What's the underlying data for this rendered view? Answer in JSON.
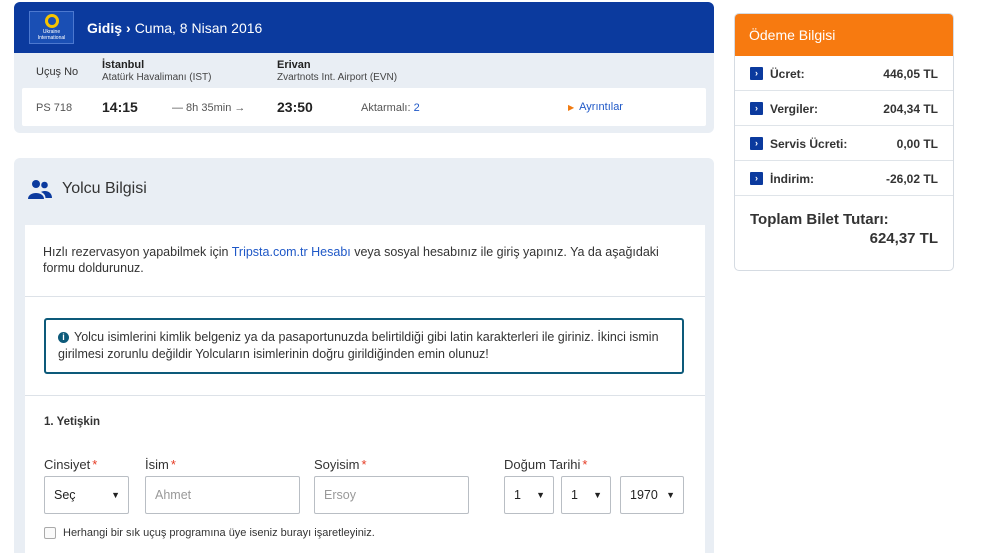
{
  "flight": {
    "airline_logo_text": "Ukraine International",
    "direction": "Gidiş",
    "separator": "›",
    "date": "Cuma, 8 Nisan 2016",
    "flight_no_label": "Uçuş No",
    "origin_city": "İstanbul",
    "origin_airport": "Atatürk Havalimanı (IST)",
    "dest_city": "Erivan",
    "dest_airport": "Zvartnots Int. Airport (EVN)",
    "code": "PS 718",
    "departure": "14:15",
    "duration": "— 8h 35min →",
    "arrival": "23:50",
    "stops_label": "Aktarmalı:",
    "stops_count": "2",
    "details_link": "Ayrıntılar"
  },
  "passenger": {
    "section_title": "Yolcu Bilgisi",
    "intro_pre": "Hızlı rezervasyon yapabilmek için ",
    "intro_link": "Tripsta.com.tr Hesabı",
    "intro_post": " veya sosyal hesabınız ile giriş yapınız. Ya da aşağıdaki formu doldurunuz.",
    "info_note": "Yolcu isimlerini kimlik belgeniz ya da pasaportunuzda belirtildiği gibi latin karakterleri ile giriniz. İkinci ismin girilmesi zorunlu değildir Yolcuların isimlerinin doğru girildiğinden emin olunuz!",
    "adult_title": "1. Yetişkin",
    "gender_label": "Cinsiyet",
    "gender_value": "Seç",
    "first_name_label": "İsim",
    "first_name_placeholder": "Ahmet",
    "last_name_label": "Soyisim",
    "last_name_placeholder": "Ersoy",
    "birth_label": "Doğum Tarihi",
    "birth_day": "1",
    "birth_month": "1",
    "birth_year": "1970",
    "required_mark": "*",
    "ffp_checkbox_label": "Herhangi bir sık uçuş programına üye iseniz burayı işaretleyiniz."
  },
  "payment": {
    "title": "Ödeme Bilgisi",
    "lines": [
      {
        "name": "Ücret:",
        "value": "446,05 TL"
      },
      {
        "name": "Vergiler:",
        "value": "204,34 TL"
      },
      {
        "name": "Servis Ücreti:",
        "value": "0,00 TL"
      },
      {
        "name": "İndirim:",
        "value": "-26,02 TL"
      }
    ],
    "total_label": "Toplam Bilet Tutarı:",
    "total_value": "624,37 TL"
  },
  "colors": {
    "header_blue": "#0b3a9e",
    "accent_orange": "#f77a10",
    "link_blue": "#1f58c7",
    "required_red": "#e53b24"
  }
}
